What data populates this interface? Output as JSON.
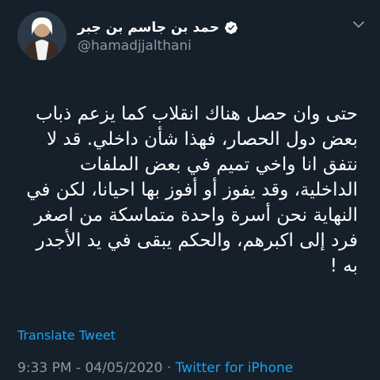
{
  "user": {
    "display_name": "حمد بن جاسم بن جبر",
    "handle": "@hamadjjalthani"
  },
  "tweet": {
    "text": "حتى وان حصل هناك انقلاب كما يزعم ذباب بعض دول الحصار، فهذا شأن داخلي. قد لا نتفق انا واخي تميم في بعض الملفات الداخلية، وقد يفوز أو أفوز بها احيانا، لكن في النهاية نحن أسرة واحدة متماسكة من اصغر فرد إلى اكبرهم، والحكم يبقى في يد الأجدر به !",
    "translate_label": "Translate Tweet",
    "time": "9:33 PM",
    "date": "04/05/2020",
    "separator": " · ",
    "source": "Twitter for iPhone"
  },
  "icons": {
    "verified": "verified-badge-icon",
    "more": "chevron-down-icon"
  },
  "colors": {
    "background": "#15202b",
    "text": "#ffffff",
    "secondary": "#8899a6",
    "accent": "#1da1f2"
  }
}
